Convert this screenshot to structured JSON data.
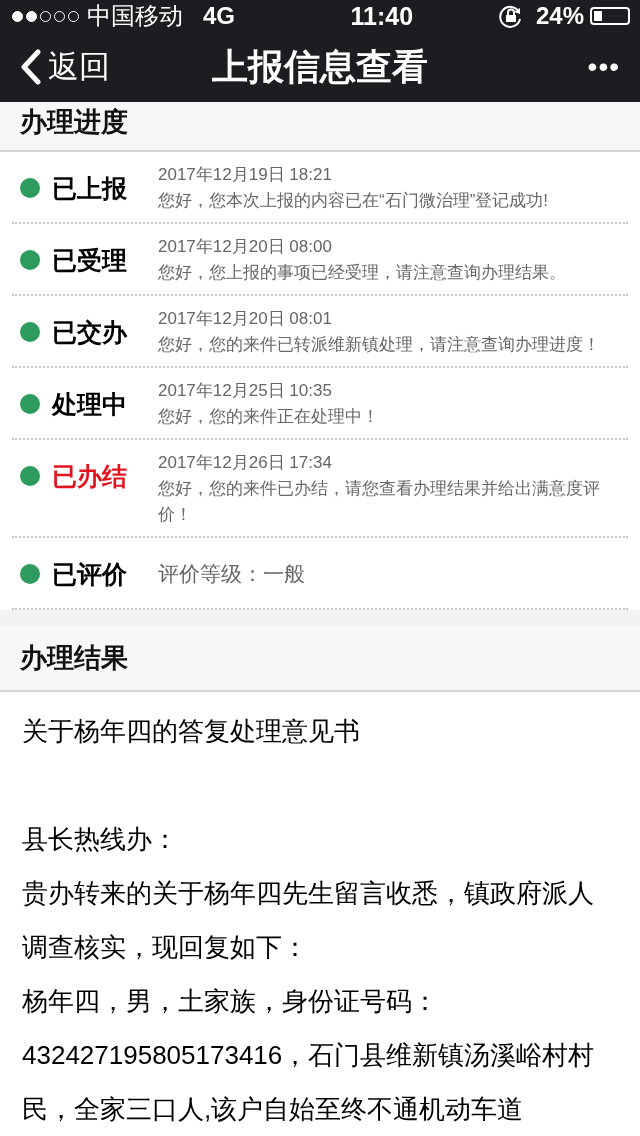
{
  "status_bar": {
    "carrier": "中国移动",
    "network": "4G",
    "time": "11:40",
    "battery": "24%"
  },
  "nav": {
    "back": "返回",
    "title": "上报信息查看",
    "more": "•••"
  },
  "progress": {
    "title": "办理进度",
    "steps": [
      {
        "label": "已上报",
        "color": "#000000",
        "date": "2017年12月19日 18:21",
        "message": "您好，您本次上报的内容已在“石门微治理”登记成功!"
      },
      {
        "label": "已受理",
        "color": "#000000",
        "date": "2017年12月20日 08:00",
        "message": "您好，您上报的事项已经受理，请注意查询办理结果。"
      },
      {
        "label": "已交办",
        "color": "#000000",
        "date": "2017年12月20日 08:01",
        "message": "您好，您的来件已转派维新镇处理，请注意查询办理进度！"
      },
      {
        "label": "处理中",
        "color": "#000000",
        "date": "2017年12月25日 10:35",
        "message": "您好，您的来件正在处理中！"
      },
      {
        "label": "已办结",
        "color": "#e0141e",
        "date": "2017年12月26日 17:34",
        "message": "您好，您的来件已办结，请您查看办理结果并给出满意度评价！"
      },
      {
        "label": "已评价",
        "color": "#000000",
        "message": "评价等级：一般"
      }
    ]
  },
  "result": {
    "title": "办理结果",
    "heading": "关于杨年四的答复处理意见书",
    "paragraphs": [
      "县长热线办：",
      "贵办转来的关于杨年四先生留言收悉，镇政府派人调查核实，现回复如下：",
      "杨年四，男，土家族，身份证号码：432427195805173416，石门县维新镇汤溪峪村村民，全家三口人,该户自始至终不通机动车道"
    ]
  }
}
